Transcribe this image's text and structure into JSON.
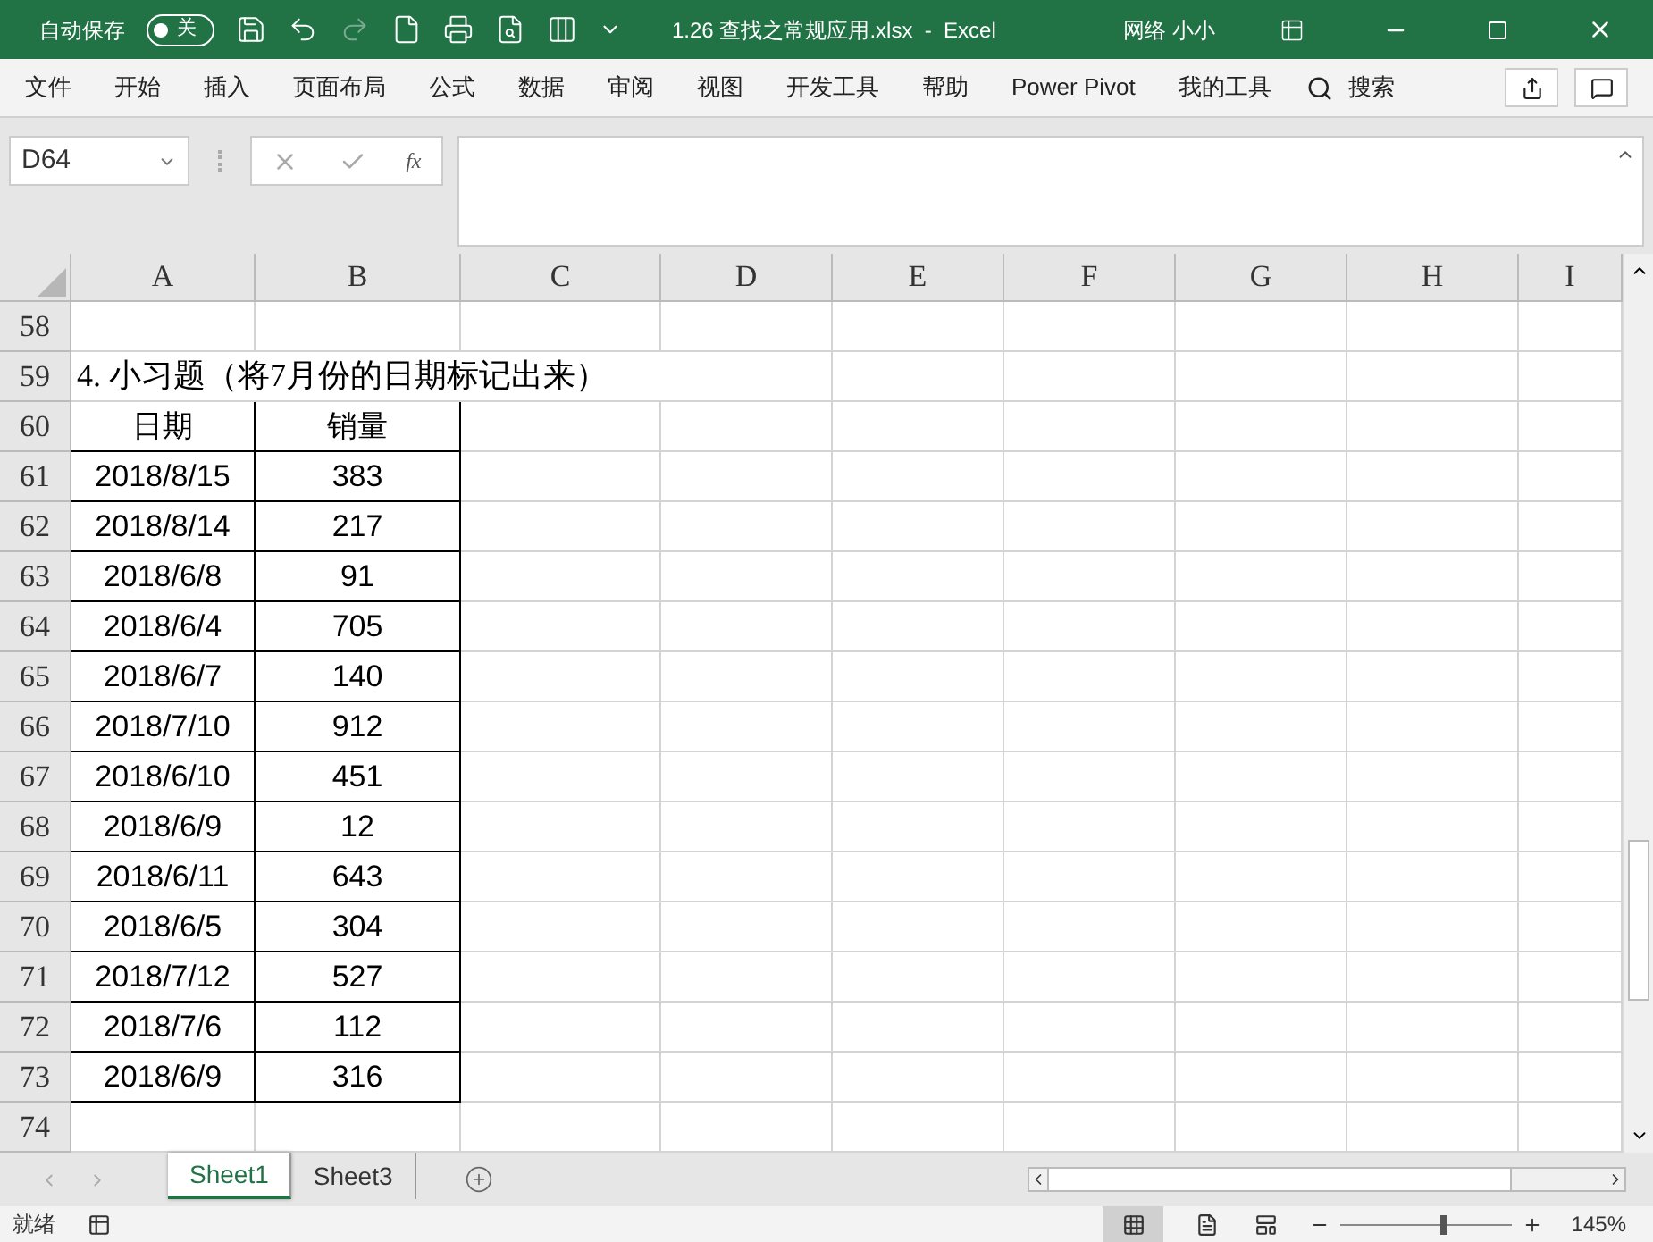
{
  "title_bar": {
    "autosave_label": "自动保存",
    "autosave_toggle": {
      "label": "关",
      "on": false
    },
    "title": "1.26 查找之常规应用.xlsx  -  Excel",
    "user": "网络 小小"
  },
  "menu": {
    "items": [
      "文件",
      "开始",
      "插入",
      "页面布局",
      "公式",
      "数据",
      "审阅",
      "视图",
      "开发工具",
      "帮助",
      "Power Pivot",
      "我的工具"
    ],
    "search": "搜索"
  },
  "name_box": "D64",
  "function_button": "fx",
  "columns": [
    "A",
    "B",
    "C",
    "D",
    "E",
    "F",
    "G",
    "H",
    "I"
  ],
  "rows": [
    {
      "number": "58",
      "kind": "blank"
    },
    {
      "number": "59",
      "kind": "title",
      "text": "4. 小习题（将7月份的日期标记出来）"
    },
    {
      "number": "60",
      "kind": "table",
      "cells": [
        "日期",
        "销量"
      ]
    },
    {
      "number": "61",
      "kind": "table",
      "cells": [
        "2018/8/15",
        "383"
      ]
    },
    {
      "number": "62",
      "kind": "table",
      "cells": [
        "2018/8/14",
        "217"
      ]
    },
    {
      "number": "63",
      "kind": "table",
      "cells": [
        "2018/6/8",
        "91"
      ]
    },
    {
      "number": "64",
      "kind": "table",
      "cells": [
        "2018/6/4",
        "705"
      ]
    },
    {
      "number": "65",
      "kind": "table",
      "cells": [
        "2018/6/7",
        "140"
      ]
    },
    {
      "number": "66",
      "kind": "table",
      "cells": [
        "2018/7/10",
        "912"
      ]
    },
    {
      "number": "67",
      "kind": "table",
      "cells": [
        "2018/6/10",
        "451"
      ]
    },
    {
      "number": "68",
      "kind": "table",
      "cells": [
        "2018/6/9",
        "12"
      ]
    },
    {
      "number": "69",
      "kind": "table",
      "cells": [
        "2018/6/11",
        "643"
      ]
    },
    {
      "number": "70",
      "kind": "table",
      "cells": [
        "2018/6/5",
        "304"
      ]
    },
    {
      "number": "71",
      "kind": "table",
      "cells": [
        "2018/7/12",
        "527"
      ]
    },
    {
      "number": "72",
      "kind": "table",
      "cells": [
        "2018/7/6",
        "112"
      ]
    },
    {
      "number": "73",
      "kind": "table",
      "cells": [
        "2018/6/9",
        "316"
      ]
    },
    {
      "number": "74",
      "kind": "blank"
    }
  ],
  "sheet_tabs": [
    {
      "label": "Sheet1",
      "selected": true
    },
    {
      "label": "Sheet3",
      "selected": false
    }
  ],
  "status_bar": {
    "status": "就绪",
    "level": 0.6,
    "zoom": "145%"
  }
}
